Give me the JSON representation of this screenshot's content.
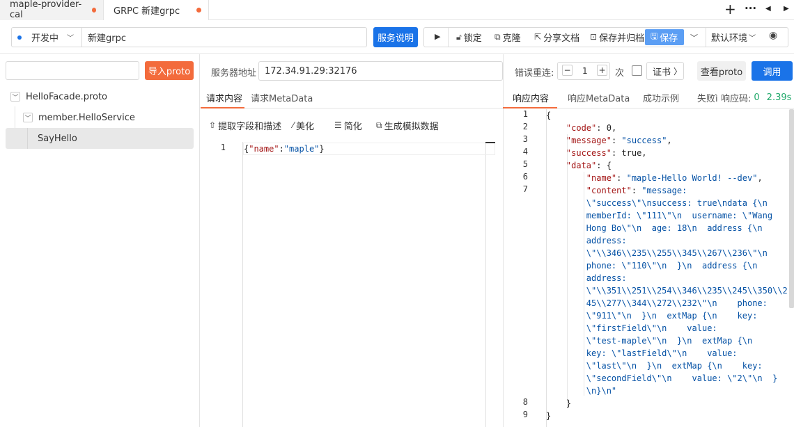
{
  "tabs": [
    {
      "label": "maple-provider-cal",
      "modified": true
    },
    {
      "label": "GRPC 新建grpc",
      "modified": true
    }
  ],
  "tabbar_icons": [
    "plus-icon",
    "more-icon",
    "arrow-left-icon",
    "arrow-right-icon"
  ],
  "toolbar": {
    "env_status": "开发中",
    "name_value": "新建grpc",
    "service_doc": "服务说明",
    "lock": "锁定",
    "clone": "克隆",
    "share": "分享文档",
    "save_archive": "保存并归档",
    "save": "保存",
    "env": "默认环境"
  },
  "left": {
    "search_value": "",
    "import_proto": "导入proto",
    "tree": [
      {
        "label": "HelloFacade.proto",
        "level": 0
      },
      {
        "label": "member.HelloService",
        "level": 1
      },
      {
        "label": "SayHello",
        "level": 2,
        "selected": true
      }
    ]
  },
  "server": {
    "label": "服务器地址",
    "address": "172.34.91.29:32176",
    "retry_label": "错误重连:",
    "retry_value": "1",
    "retry_unit": "次",
    "cert": "证书",
    "view_proto": "查看proto",
    "invoke": "调用"
  },
  "request": {
    "tabs": [
      "请求内容",
      "请求MetaData"
    ],
    "actions": [
      "提取字段和描述",
      "美化",
      "简化",
      "生成模拟数据"
    ],
    "line_numbers": [
      "1"
    ],
    "body": "{\"name\":\"maple\"}"
  },
  "response": {
    "tabs": [
      "响应内容",
      "响应MetaData",
      "成功示例",
      "失败ì"
    ],
    "code_label": "响应码:",
    "code_value": "0",
    "time": "2.39s",
    "line_numbers": [
      "1",
      "2",
      "3",
      "4",
      "5",
      "6",
      "7",
      "8",
      "9"
    ],
    "lines": [
      "{",
      "    \"code\": 0,",
      "    \"message\": \"success\",",
      "    \"success\": true,",
      "    \"data\": {",
      "        \"name\": \"maple-Hello World! --dev\",",
      "        \"content\": \"message:",
      "        \\\"success\\\"\\nsuccess: true\\ndata {\\n",
      "        memberId: \\\"111\\\"\\n  username: \\\"Wang",
      "        Hong Bo\\\"\\n  age: 18\\n  address {\\n",
      "        address:",
      "        \\\"\\\\346\\\\235\\\\255\\\\345\\\\267\\\\236\\\"\\n",
      "        phone: \\\"110\\\"\\n  }\\n  address {\\n",
      "        address:",
      "        \\\"\\\\351\\\\251\\\\254\\\\346\\\\235\\\\245\\\\350\\\\2",
      "        45\\\\277\\\\344\\\\272\\\\232\\\"\\n    phone:",
      "        \\\"911\\\"\\n  }\\n  extMap {\\n    key:",
      "        \\\"firstField\\\"\\n    value:",
      "        \\\"test-maple\\\"\\n  }\\n  extMap {\\n",
      "        key: \\\"lastField\\\"\\n    value:",
      "        \\\"last\\\"\\n  }\\n  extMap {\\n    key:",
      "        \\\"secondField\\\"\\n    value: \\\"2\\\"\\n  }",
      "        \\n}\\n\"",
      "    }",
      "}"
    ]
  },
  "colors": {
    "accent": "#1a73e8",
    "orange": "#f36b3c",
    "green": "#21a96b"
  }
}
